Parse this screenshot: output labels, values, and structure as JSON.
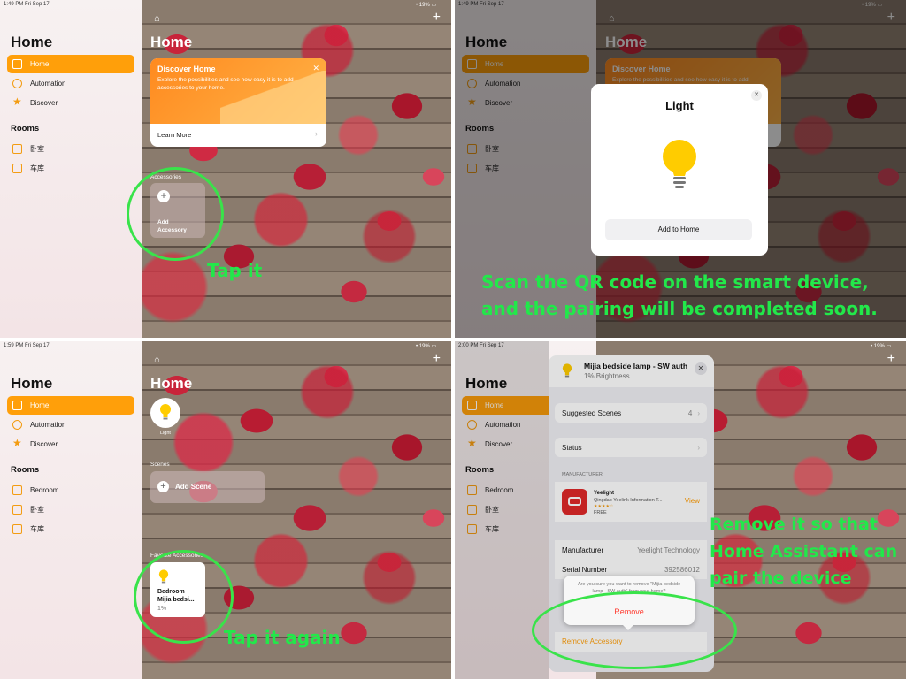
{
  "panels": [
    {
      "status": {
        "time": "1:49 PM  Fri Sep 17",
        "right": "• 19% ▭"
      }
    },
    {
      "status": {
        "time": "1:49 PM  Fri Sep 17",
        "right": "• 19% ▭"
      }
    },
    {
      "status": {
        "time": "1:59 PM  Fri Sep 17",
        "right": "• 19% ▭"
      }
    },
    {
      "status": {
        "time": "2:00 PM  Fri Sep 17",
        "right": "• 19% ▭"
      }
    }
  ],
  "sidebar": {
    "title": "Home",
    "items": [
      "Home",
      "Automation",
      "Discover"
    ],
    "rooms_heading": "Rooms",
    "rooms": [
      "Bedroom",
      "卧室",
      "车库"
    ]
  },
  "main": {
    "title": "Home"
  },
  "discover_card": {
    "title": "Discover Home",
    "text": "Explore the possibilities and see how easy it is to add accessories to your home.",
    "link": "Learn More"
  },
  "accessories": {
    "heading": "Accessories",
    "add_label": "Add Accessory"
  },
  "light_modal": {
    "title": "Light",
    "button": "Add to Home"
  },
  "light_tile": {
    "label": "Light"
  },
  "scenes": {
    "heading": "Scenes",
    "add_label": "Add Scene"
  },
  "favorites": {
    "heading": "Favorite Accessories",
    "tile_line1": "Bedroom",
    "tile_line2": "Mijia bedsi...",
    "tile_line3": "1%"
  },
  "detail": {
    "title": "Mijia bedside lamp - SW auth",
    "subtitle": "1% Brightness",
    "suggested": "Suggested Scenes",
    "suggested_count": "4",
    "status": "Status",
    "manufacturer_heading": "MANUFACTURER",
    "app_name": "Yeelight",
    "app_company": "Qingdao Yeelink Information T...",
    "app_price": "FREE",
    "app_view": "View",
    "app_stars": "★★★★☆",
    "manufacturer_label": "Manufacturer",
    "manufacturer_value": "Yeelight Technology",
    "serial_label": "Serial Number",
    "serial_value": "392586012",
    "confirm_text": "Are you sure you want to remove \"Mijia bedside lamp - SW auth\" from your home?",
    "remove_button": "Remove",
    "remove_accessory": "Remove Accessory"
  },
  "annotations": {
    "tap_it": "Tap it",
    "scan": "Scan the QR code on the smart device,",
    "scan2": "and the pairing will be completed soon.",
    "tap_again": "Tap it again",
    "remove1": "Remove it so that",
    "remove2": "Home Assistant can",
    "remove3": "pair the device"
  },
  "colors": {
    "accent": "#ff9f0a",
    "annotation": "#22e84a",
    "destructive": "#ff3b30"
  }
}
